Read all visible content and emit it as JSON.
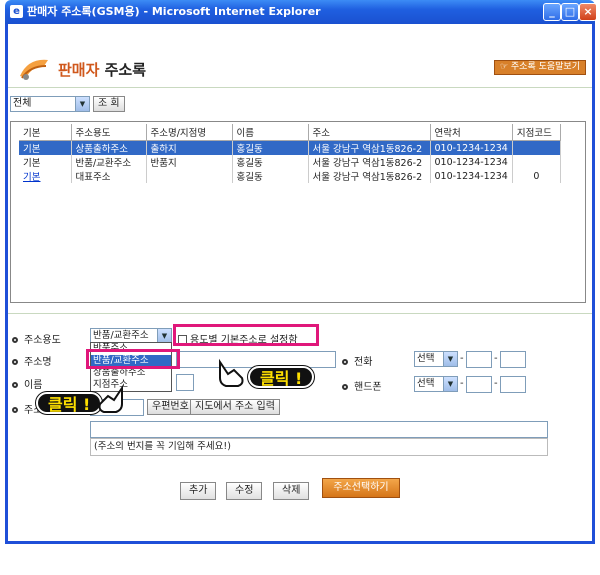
{
  "window": {
    "title": "판매자 주소록(GSM용) - Microsoft Internet Explorer",
    "icon_glyph": "e",
    "controls": [
      "_",
      "□",
      "×"
    ]
  },
  "header": {
    "title_accent": "판매자",
    "title_rest": " 주소록",
    "help_button": "주소록 도움말보기",
    "accent_color": "#d0581c"
  },
  "filter": {
    "selected": "전체",
    "search_button": "조 회"
  },
  "grid": {
    "columns": [
      "기본",
      "주소용도",
      "주소명/지점명",
      "이름",
      "주소",
      "연락처",
      "지점코드"
    ],
    "rows": [
      [
        "기본",
        "상품출하주소",
        "출하지",
        "홍길동",
        "서울 강남구 역삼1동826-2",
        "010-1234-1234",
        ""
      ],
      [
        "기본",
        "반품/교환주소",
        "반품지",
        "홍길동",
        "서울 강남구 역삼1동826-2",
        "010-1234-1234",
        ""
      ],
      [
        "기본",
        "대표주소",
        "",
        "홍길동",
        "서울 강남구 역삼1동826-2",
        "010-1234-1234",
        "0"
      ]
    ]
  },
  "form": {
    "purpose_label": "주소용도",
    "purpose_selected": "반품/교환주소",
    "purpose_options": [
      "반품주소",
      "반품/교환주소",
      "상품출하주소",
      "지점주소"
    ],
    "set_default_label": "용도별 기본주소로 설정함",
    "name_label": "주소명",
    "person_label": "이름",
    "addr_label": "주소",
    "zip_button": "우편번호",
    "map_button": "지도에서 주소 입력",
    "addr_note": "(주소의 번지를 꼭 기입해 주세요!)",
    "phone_label": "전화",
    "mobile_label": "핸드폰",
    "phone_select": "선택",
    "mobile_select": "선택",
    "dash": "-"
  },
  "callouts": {
    "click1": "클릭 !",
    "click2": "클릭 !"
  },
  "actions": {
    "add": "추가",
    "edit": "수정",
    "delete": "삭제",
    "select_address": "주소선택하기"
  }
}
